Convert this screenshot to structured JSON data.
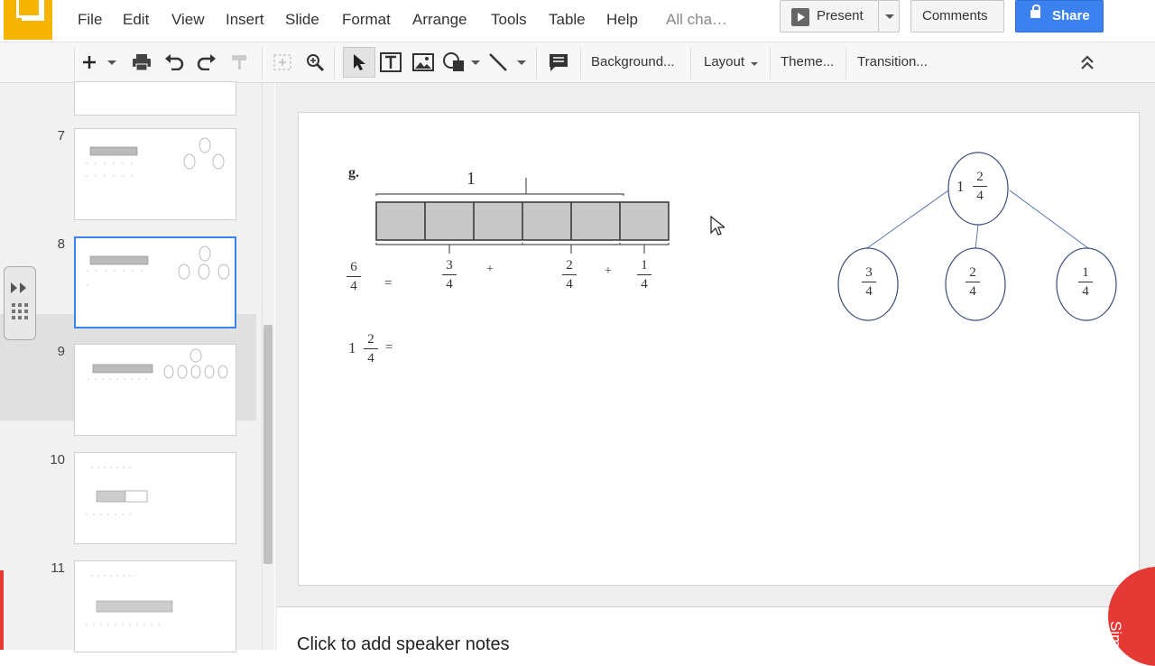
{
  "menu": [
    "File",
    "Edit",
    "View",
    "Insert",
    "Slide",
    "Format",
    "Arrange",
    "Tools",
    "Table",
    "Help"
  ],
  "menu_status": "All cha…",
  "header": {
    "present": "Present",
    "comments": "Comments",
    "share": "Share"
  },
  "toolbar": {
    "background": "Background...",
    "layout": "Layout",
    "theme": "Theme...",
    "transition": "Transition..."
  },
  "slides": [
    {
      "num": "7"
    },
    {
      "num": "8",
      "selected": true
    },
    {
      "num": "9"
    },
    {
      "num": "10"
    },
    {
      "num": "11"
    }
  ],
  "slide": {
    "label": "g.",
    "whole_label": "1",
    "left_eq": {
      "f1": {
        "n": "6",
        "d": "4"
      },
      "eq": "=",
      "f2": {
        "n": "3",
        "d": "4"
      },
      "plus1": "+",
      "f3": {
        "n": "2",
        "d": "4"
      },
      "plus2": "+",
      "f4": {
        "n": "1",
        "d": "4"
      }
    },
    "mixed_eq": {
      "whole": "1",
      "n": "2",
      "d": "4",
      "eq": "="
    },
    "bond": {
      "top": {
        "whole": "1",
        "n": "2",
        "d": "4"
      },
      "a": {
        "n": "3",
        "d": "4"
      },
      "b": {
        "n": "2",
        "d": "4"
      },
      "c": {
        "n": "1",
        "d": "4"
      }
    }
  },
  "notes_placeholder": "Click to add speaker notes",
  "watermark": "SimpleTa",
  "colors": {
    "accent": "#3b82f0",
    "logo": "#f4b400",
    "shade": "#c8c8c8"
  }
}
